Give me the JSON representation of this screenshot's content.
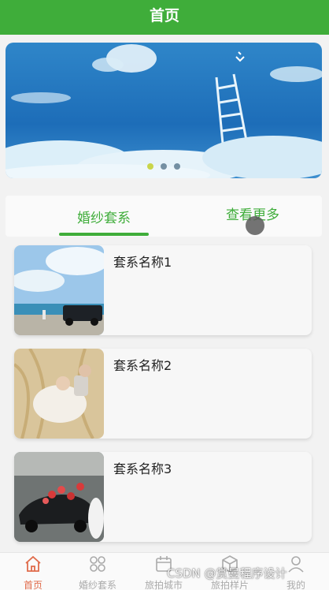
{
  "header": {
    "title": "首页"
  },
  "banner": {
    "slides": 3,
    "active_slide": 0
  },
  "tabs": {
    "primary_label": "婚纱套系",
    "more_label": "查看更多"
  },
  "packages": [
    {
      "name": "套系名称1"
    },
    {
      "name": "套系名称2"
    },
    {
      "name": "套系名称3"
    }
  ],
  "bottom_nav": [
    {
      "label": "首页",
      "icon": "home-icon",
      "active": true
    },
    {
      "label": "婚纱套系",
      "icon": "grid-flower-icon",
      "active": false
    },
    {
      "label": "旅拍城市",
      "icon": "calendar-icon",
      "active": false
    },
    {
      "label": "旅拍样片",
      "icon": "box-icon",
      "active": false
    },
    {
      "label": "我的",
      "icon": "user-icon",
      "active": false
    }
  ],
  "watermark": "CSDN @赏曼程序设计",
  "colors": {
    "brand_green": "#3fad3a",
    "active_nav": "#e06b4a",
    "inactive_nav": "#aaaaaa"
  }
}
